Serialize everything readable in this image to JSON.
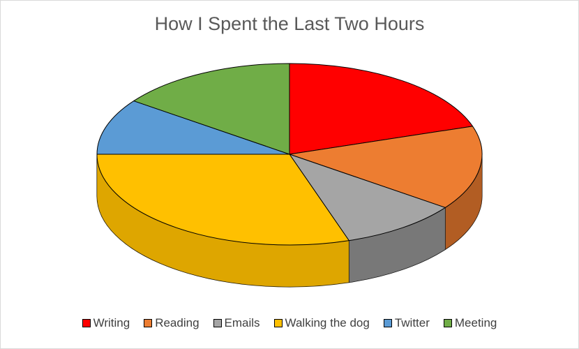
{
  "chart_data": {
    "type": "pie",
    "title": "How I Spent the Last Two Hours",
    "categories": [
      "Writing",
      "Reading",
      "Emails",
      "Walking the dog",
      "Twitter",
      "Meeting"
    ],
    "values": [
      20,
      15,
      10,
      30,
      10,
      15
    ],
    "colors": [
      "#ff0000",
      "#ed7d31",
      "#a5a5a5",
      "#ffc000",
      "#5b9bd5",
      "#70ad47"
    ],
    "side_colors": [
      "#8b0000",
      "#6a3512",
      "#404040",
      "#b58800",
      "#2e5f8a",
      "#3d6a27"
    ],
    "legend_position": "bottom",
    "three_d": true
  }
}
